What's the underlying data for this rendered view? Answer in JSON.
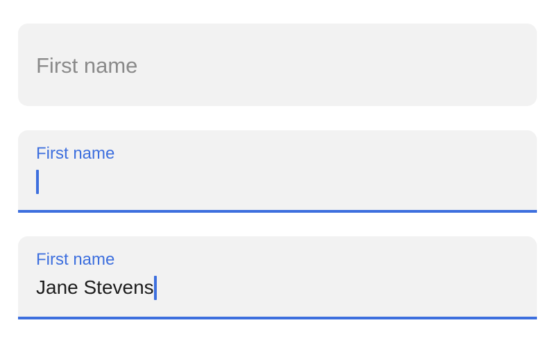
{
  "colors": {
    "accent": "#3d6fde",
    "field_background": "#f2f2f2",
    "placeholder": "#8a8a8a",
    "text": "#1c1c1c"
  },
  "fields": [
    {
      "state": "idle",
      "placeholder": "First name"
    },
    {
      "state": "focused",
      "label": "First name",
      "value": ""
    },
    {
      "state": "filled",
      "label": "First name",
      "value": "Jane Stevens"
    }
  ]
}
